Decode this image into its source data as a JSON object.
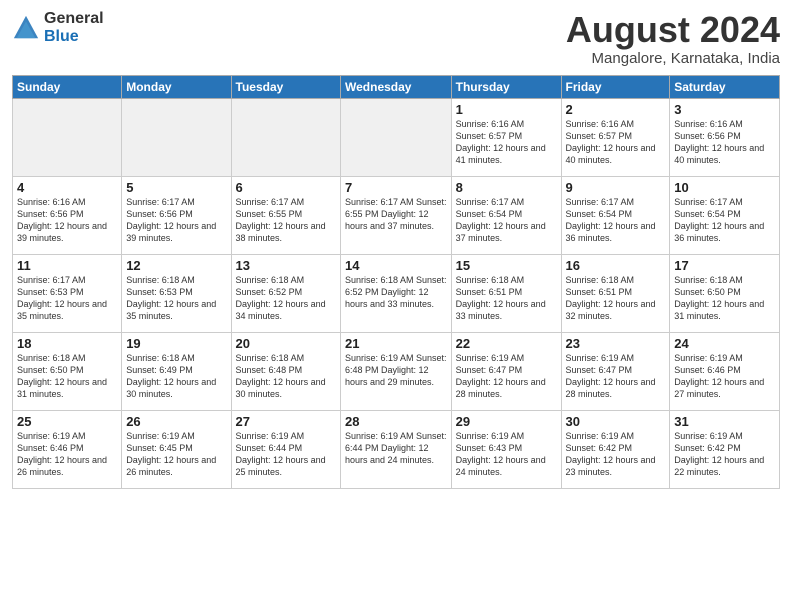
{
  "header": {
    "logo_general": "General",
    "logo_blue": "Blue",
    "title": "August 2024",
    "location": "Mangalore, Karnataka, India"
  },
  "days_of_week": [
    "Sunday",
    "Monday",
    "Tuesday",
    "Wednesday",
    "Thursday",
    "Friday",
    "Saturday"
  ],
  "weeks": [
    [
      {
        "day": "",
        "info": ""
      },
      {
        "day": "",
        "info": ""
      },
      {
        "day": "",
        "info": ""
      },
      {
        "day": "",
        "info": ""
      },
      {
        "day": "1",
        "info": "Sunrise: 6:16 AM\nSunset: 6:57 PM\nDaylight: 12 hours\nand 41 minutes."
      },
      {
        "day": "2",
        "info": "Sunrise: 6:16 AM\nSunset: 6:57 PM\nDaylight: 12 hours\nand 40 minutes."
      },
      {
        "day": "3",
        "info": "Sunrise: 6:16 AM\nSunset: 6:56 PM\nDaylight: 12 hours\nand 40 minutes."
      }
    ],
    [
      {
        "day": "4",
        "info": "Sunrise: 6:16 AM\nSunset: 6:56 PM\nDaylight: 12 hours\nand 39 minutes."
      },
      {
        "day": "5",
        "info": "Sunrise: 6:17 AM\nSunset: 6:56 PM\nDaylight: 12 hours\nand 39 minutes."
      },
      {
        "day": "6",
        "info": "Sunrise: 6:17 AM\nSunset: 6:55 PM\nDaylight: 12 hours\nand 38 minutes."
      },
      {
        "day": "7",
        "info": "Sunrise: 6:17 AM\nSunset: 6:55 PM\nDaylight: 12 hours\nand 37 minutes."
      },
      {
        "day": "8",
        "info": "Sunrise: 6:17 AM\nSunset: 6:54 PM\nDaylight: 12 hours\nand 37 minutes."
      },
      {
        "day": "9",
        "info": "Sunrise: 6:17 AM\nSunset: 6:54 PM\nDaylight: 12 hours\nand 36 minutes."
      },
      {
        "day": "10",
        "info": "Sunrise: 6:17 AM\nSunset: 6:54 PM\nDaylight: 12 hours\nand 36 minutes."
      }
    ],
    [
      {
        "day": "11",
        "info": "Sunrise: 6:17 AM\nSunset: 6:53 PM\nDaylight: 12 hours\nand 35 minutes."
      },
      {
        "day": "12",
        "info": "Sunrise: 6:18 AM\nSunset: 6:53 PM\nDaylight: 12 hours\nand 35 minutes."
      },
      {
        "day": "13",
        "info": "Sunrise: 6:18 AM\nSunset: 6:52 PM\nDaylight: 12 hours\nand 34 minutes."
      },
      {
        "day": "14",
        "info": "Sunrise: 6:18 AM\nSunset: 6:52 PM\nDaylight: 12 hours\nand 33 minutes."
      },
      {
        "day": "15",
        "info": "Sunrise: 6:18 AM\nSunset: 6:51 PM\nDaylight: 12 hours\nand 33 minutes."
      },
      {
        "day": "16",
        "info": "Sunrise: 6:18 AM\nSunset: 6:51 PM\nDaylight: 12 hours\nand 32 minutes."
      },
      {
        "day": "17",
        "info": "Sunrise: 6:18 AM\nSunset: 6:50 PM\nDaylight: 12 hours\nand 31 minutes."
      }
    ],
    [
      {
        "day": "18",
        "info": "Sunrise: 6:18 AM\nSunset: 6:50 PM\nDaylight: 12 hours\nand 31 minutes."
      },
      {
        "day": "19",
        "info": "Sunrise: 6:18 AM\nSunset: 6:49 PM\nDaylight: 12 hours\nand 30 minutes."
      },
      {
        "day": "20",
        "info": "Sunrise: 6:18 AM\nSunset: 6:48 PM\nDaylight: 12 hours\nand 30 minutes."
      },
      {
        "day": "21",
        "info": "Sunrise: 6:19 AM\nSunset: 6:48 PM\nDaylight: 12 hours\nand 29 minutes."
      },
      {
        "day": "22",
        "info": "Sunrise: 6:19 AM\nSunset: 6:47 PM\nDaylight: 12 hours\nand 28 minutes."
      },
      {
        "day": "23",
        "info": "Sunrise: 6:19 AM\nSunset: 6:47 PM\nDaylight: 12 hours\nand 28 minutes."
      },
      {
        "day": "24",
        "info": "Sunrise: 6:19 AM\nSunset: 6:46 PM\nDaylight: 12 hours\nand 27 minutes."
      }
    ],
    [
      {
        "day": "25",
        "info": "Sunrise: 6:19 AM\nSunset: 6:46 PM\nDaylight: 12 hours\nand 26 minutes."
      },
      {
        "day": "26",
        "info": "Sunrise: 6:19 AM\nSunset: 6:45 PM\nDaylight: 12 hours\nand 26 minutes."
      },
      {
        "day": "27",
        "info": "Sunrise: 6:19 AM\nSunset: 6:44 PM\nDaylight: 12 hours\nand 25 minutes."
      },
      {
        "day": "28",
        "info": "Sunrise: 6:19 AM\nSunset: 6:44 PM\nDaylight: 12 hours\nand 24 minutes."
      },
      {
        "day": "29",
        "info": "Sunrise: 6:19 AM\nSunset: 6:43 PM\nDaylight: 12 hours\nand 24 minutes."
      },
      {
        "day": "30",
        "info": "Sunrise: 6:19 AM\nSunset: 6:42 PM\nDaylight: 12 hours\nand 23 minutes."
      },
      {
        "day": "31",
        "info": "Sunrise: 6:19 AM\nSunset: 6:42 PM\nDaylight: 12 hours\nand 22 minutes."
      }
    ]
  ]
}
